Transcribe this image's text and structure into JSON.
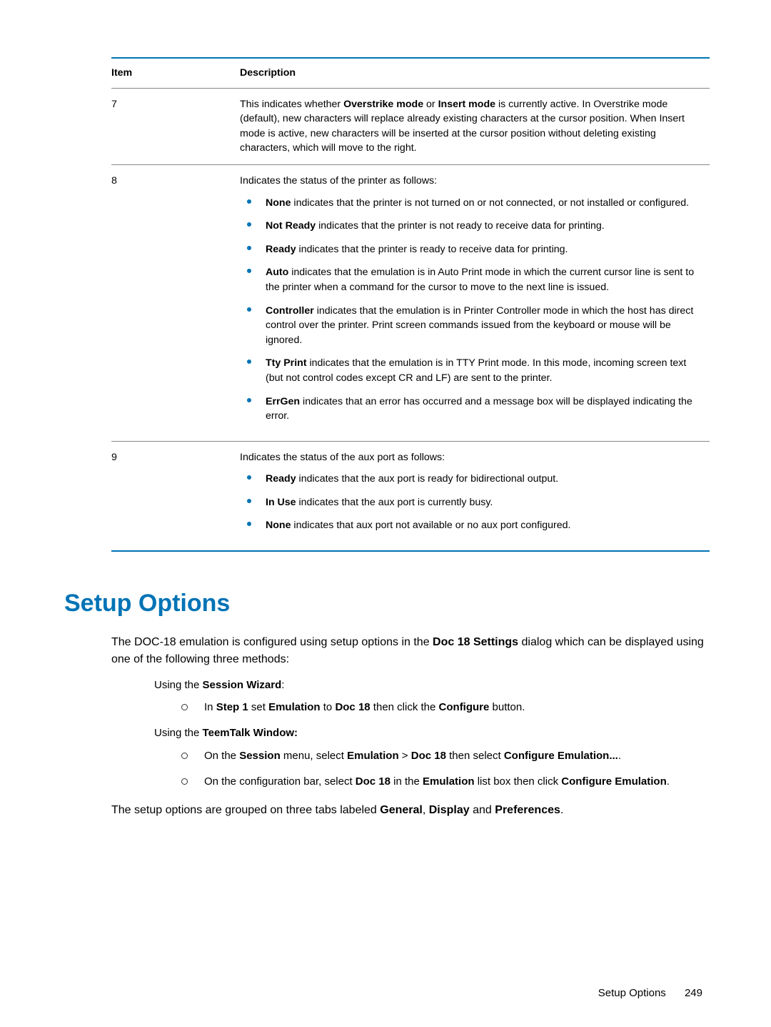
{
  "table": {
    "headers": {
      "item": "Item",
      "desc": "Description"
    },
    "rows": {
      "r7": {
        "num": "7",
        "t1": "This indicates whether ",
        "b1": "Overstrike mode",
        "t2": " or ",
        "b2": "Insert mode",
        "t3": " is currently active. In Overstrike mode (default), new characters will replace already existing characters at the cursor position. When Insert mode is active, new characters will be inserted at the cursor position without deleting existing characters, which will move to the right."
      },
      "r8": {
        "num": "8",
        "intro": "Indicates the status of the printer as follows:",
        "li": {
          "none": {
            "b": "None",
            "t": " indicates that the printer is not turned on or not connected, or not installed or configured."
          },
          "notready": {
            "b": "Not Ready",
            "t": " indicates that the printer is not ready to receive data for printing."
          },
          "ready": {
            "b": "Ready",
            "t": " indicates that the printer is ready to receive data for printing."
          },
          "auto": {
            "b": "Auto",
            "t": " indicates that the emulation is in Auto Print mode in which the current cursor line is sent to the printer when a command for the cursor to move to the next line is issued."
          },
          "controller": {
            "b": "Controller",
            "t": " indicates that the emulation is in Printer Controller mode in which the host has direct control over the printer. Print screen commands issued from the keyboard or mouse will be ignored."
          },
          "tty": {
            "b": "Tty Print",
            "t": " indicates that the emulation is in TTY Print mode. In this mode, incoming screen text (but not control codes except CR and LF) are sent to the printer."
          },
          "errgen": {
            "b": "ErrGen",
            "t": " indicates that an error has occurred and a message box will be displayed indicating the error."
          }
        }
      },
      "r9": {
        "num": "9",
        "intro": "Indicates the status of the aux port as follows:",
        "li": {
          "ready": {
            "b": "Ready",
            "t": " indicates that the aux port is ready for bidirectional output."
          },
          "inuse": {
            "b": "In Use",
            "t": " indicates that the aux port is currently busy."
          },
          "none": {
            "b": "None",
            "t": " indicates that aux port not available or no aux port configured."
          }
        }
      }
    }
  },
  "section": {
    "heading": "Setup Options"
  },
  "para1": {
    "t1": "The DOC-18 emulation is configured using setup options in the ",
    "b1": "Doc 18 Settings",
    "t2": " dialog which can be displayed using one of the following three methods:"
  },
  "wizard": {
    "t1": "Using the ",
    "b1": "Session Wizard",
    "t2": ":",
    "li1": {
      "p1": "In ",
      "b1": "Step 1",
      "p2": " set ",
      "b2": "Emulation",
      "p3": " to ",
      "b3": "Doc 18",
      "p4": " then click the ",
      "b4": "Configure",
      "p5": " button."
    }
  },
  "teemtalk": {
    "t1": "Using the ",
    "b1": "TeemTalk Window:",
    "li1": {
      "p1": "On the ",
      "b1": "Session",
      "p2": " menu, select ",
      "b2": "Emulation",
      "p3": " > ",
      "b3": "Doc 18",
      "p4": " then select ",
      "b4": "Configure Emulation...",
      "p5": "."
    },
    "li2": {
      "p1": "On the configuration bar, select ",
      "b1": "Doc 18",
      "p2": " in the ",
      "b2": "Emulation",
      "p3": " list box then click ",
      "b3": "Configure Emulation",
      "p4": "."
    }
  },
  "para2": {
    "t1": "The setup options are grouped on three tabs labeled ",
    "b1": "General",
    "c1": ", ",
    "b2": "Display",
    "c2": " and ",
    "b3": "Preferences",
    "t2": "."
  },
  "footer": {
    "label": "Setup Options",
    "page": "249"
  }
}
